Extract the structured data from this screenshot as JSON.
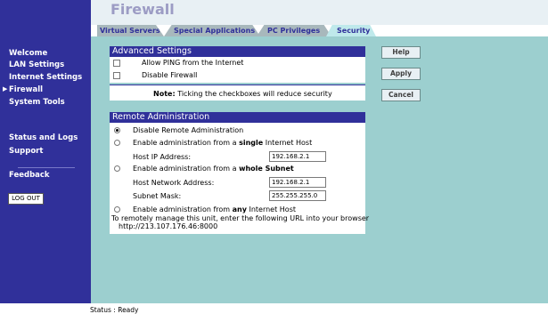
{
  "header": {
    "title": "Firewall"
  },
  "tabs": [
    {
      "label": "Virtual Servers",
      "active": false
    },
    {
      "label": "Special Applications",
      "active": false
    },
    {
      "label": "PC Privileges",
      "active": false
    },
    {
      "label": "Security",
      "active": true
    }
  ],
  "sidebar": {
    "items": [
      {
        "label": "Welcome"
      },
      {
        "label": "LAN Settings"
      },
      {
        "label": "Internet Settings"
      },
      {
        "label": "Firewall",
        "current": true
      },
      {
        "label": "System Tools"
      },
      {
        "label": "Status and Logs"
      },
      {
        "label": "Support"
      },
      {
        "label": "Feedback"
      }
    ],
    "logout_label": "LOG OUT"
  },
  "advanced": {
    "title": "Advanced Settings",
    "allow_ping": {
      "label": "Allow PING from the Internet",
      "checked": false
    },
    "disable_firewall": {
      "label": "Disable Firewall",
      "checked": false
    },
    "note_bold": "Note:",
    "note_text": "Ticking the checkboxes will reduce security"
  },
  "remote": {
    "title": "Remote Administration",
    "option_disable": {
      "label": "Disable Remote Administration",
      "selected": true
    },
    "option_single": {
      "label_pre": "Enable administration from a",
      "label_bold": "single",
      "label_post": "Internet Host",
      "selected": false
    },
    "host_ip": {
      "label": "Host IP Address:",
      "value": "192.168.2.1"
    },
    "option_subnet": {
      "label_pre": "Enable administration from a",
      "label_bold": "whole Subnet",
      "selected": false
    },
    "network_address": {
      "label": "Host Network Address:",
      "value": "192.168.2.1"
    },
    "subnet_mask": {
      "label": "Subnet Mask:",
      "value": "255.255.255.0"
    },
    "option_any": {
      "label_pre": "Enable administration from",
      "label_bold": "any",
      "label_post": "Internet Host",
      "selected": false
    },
    "info_line1": "To remotely manage this unit, enter the following URL into your browser",
    "info_line2": "http://213.107.176.46:8000"
  },
  "buttons": {
    "help": "Help",
    "apply": "Apply",
    "cancel": "Cancel"
  },
  "status": {
    "text": "Status : Ready"
  },
  "colors": {
    "nav": "#30309a",
    "content": "#9ccfcf",
    "tab_active": "#bfe9eb",
    "tab_inactive": "#a8b8bc",
    "title": "#9c9cc4"
  }
}
